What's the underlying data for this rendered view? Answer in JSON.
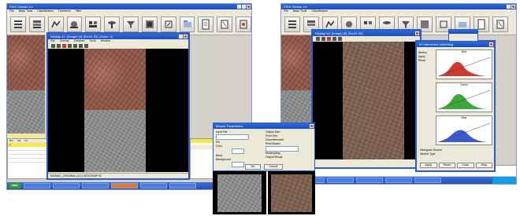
{
  "left_screen": {
    "app_title": "ENVI Classic 4.x",
    "menus": [
      "File",
      "Basic Tools",
      "Classification",
      "Transform",
      "Filter",
      "Spectral",
      "Map",
      "Vector",
      "Topographic",
      "Radar",
      "Window",
      "Help"
    ],
    "toolbar_icons": [
      "file-icon",
      "layers-icon",
      "map-icon",
      "warp-icon",
      "mosaic-icon",
      "classify-icon",
      "filter-icon",
      "spectral-icon",
      "stack-icon",
      "open-icon",
      "document-icon",
      "help-icon",
      "exit-icon"
    ],
    "image_window_title": "Display #1: (Image) [0] (Scroll: 25) (Zoom: 2)",
    "image_menus": [
      "File",
      "Overlay",
      "Enhance",
      "Tools",
      "Window"
    ],
    "image_status": "MOSAIC_ORIGINAL (1/1) GEOGRAPHIC",
    "table_cols": [
      "Bxx",
      "File",
      "Inf"
    ],
    "table_row_highlight": "1"
  },
  "right_screen": {
    "app_title": "ENVI Classic 4.x",
    "image_window_title": "Display #2: (Image) [0] (Scroll: 25)",
    "histogram_window_title": "#2 Interactive Stretching",
    "histograms": [
      {
        "name": "Red",
        "color": "#d03a2a"
      },
      {
        "name": "Green",
        "color": "#3aa83a"
      },
      {
        "name": "Blue",
        "color": "#3a5ad0"
      }
    ],
    "histogram_left_labels": [
      "Stretch",
      "Apply",
      "Reset",
      "Histogram Source",
      "Stretch Type"
    ],
    "histogram_buttons": [
      "Apply",
      "Reset",
      "Close",
      "Help"
    ]
  },
  "dialog": {
    "title": "Mosaic Parameters",
    "left_labels": [
      "Input File",
      "Fill",
      "Color",
      "Band",
      "Background",
      "Stretch"
    ],
    "right_labels": [
      "Output Size",
      "Pixel Size",
      "Mosaic Type",
      "Resampling",
      "Output Result"
    ],
    "buttons": [
      "OK",
      "Cancel"
    ],
    "radio_options": [
      "Georeferenced",
      "Pixel Based"
    ]
  },
  "colors": {
    "title_blue": "#2158c8",
    "taskbar_blue": "#2f62cc",
    "start_green": "#3a9a3a",
    "window_gray": "#ece9d8"
  }
}
